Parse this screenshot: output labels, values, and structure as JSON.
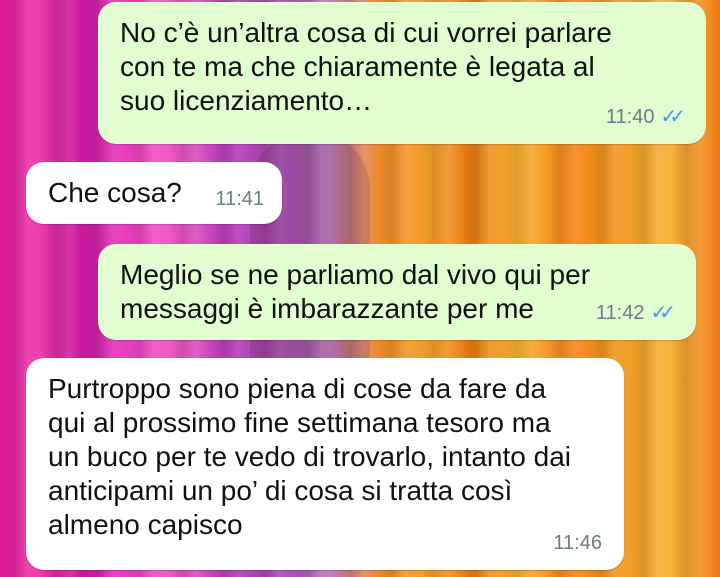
{
  "colors": {
    "outgoing_bubble": "#e2fdd0",
    "incoming_bubble": "#ffffff",
    "read_ticks": "#3d9be9",
    "timestamp": "#6b7d84"
  },
  "messages": [
    {
      "direction": "outgoing",
      "text": "No c’è un’altra cosa di cui vorrei parlare\ncon te ma che chiaramente è legata al\nsuo licenziamento…",
      "time": "11:40",
      "status_icon": "double-check-read-icon"
    },
    {
      "direction": "incoming",
      "text": "Che cosa?",
      "time": "11:41"
    },
    {
      "direction": "outgoing",
      "text": "Meglio se ne parliamo dal vivo qui per\nmessaggi è imbarazzante per me",
      "time": "11:42",
      "status_icon": "double-check-read-icon"
    },
    {
      "direction": "incoming",
      "text": "Purtroppo sono piena di cose da fare da\nqui al prossimo fine settimana tesoro ma\nun buco per te vedo di trovarlo, intanto dai\nanticipami un po’ di cosa si tratta così\nalmeno capisco",
      "time": "11:46"
    }
  ]
}
